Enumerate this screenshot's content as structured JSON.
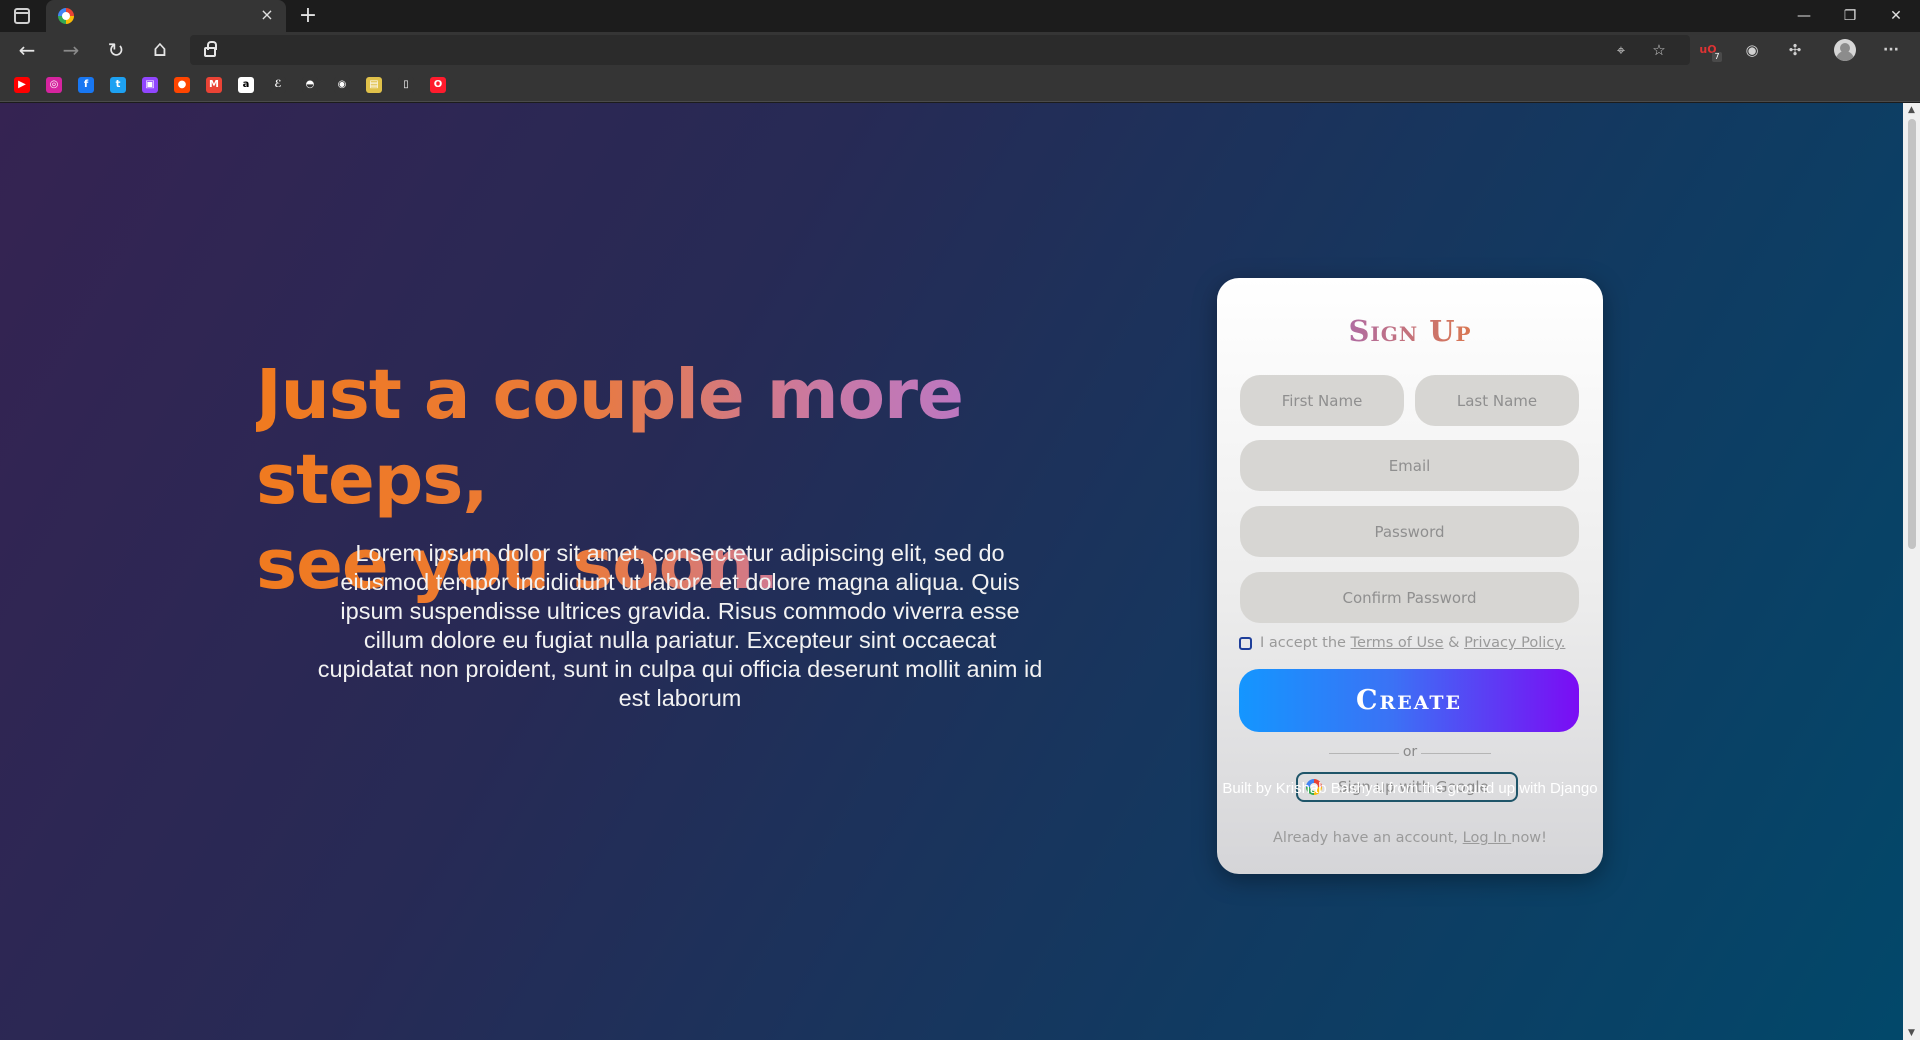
{
  "browser": {
    "tab_close": "×",
    "new_tab": "+",
    "window_controls": {
      "minimize": "—",
      "restore": "❐",
      "close": "✕"
    },
    "nav": {
      "back": "←",
      "forward": "→",
      "reload": "↻",
      "home": "⌂"
    },
    "toolbar_icons": [
      "location-icon",
      "favorites-icon",
      "ublock-extension-icon",
      "extension-icon",
      "extensions-puzzle-icon",
      "profile-avatar",
      "more-menu-icon"
    ],
    "more_menu": "···",
    "ublock_badge": "7"
  },
  "bookmarks": [
    {
      "name": "youtube",
      "glyph": "▶",
      "color": "#ff0000"
    },
    {
      "name": "instagram",
      "glyph": "◎",
      "color": "#d6249f"
    },
    {
      "name": "facebook",
      "glyph": "f",
      "color": "#1877f2"
    },
    {
      "name": "twitter",
      "glyph": "t",
      "color": "#1da1f2"
    },
    {
      "name": "twitch",
      "glyph": "▣",
      "color": "#9146ff"
    },
    {
      "name": "reddit",
      "glyph": "●",
      "color": "#ff4500"
    },
    {
      "name": "gmail",
      "glyph": "M",
      "color": "#ea4335"
    },
    {
      "name": "amazon",
      "glyph": "a",
      "color": "#ffffff"
    },
    {
      "name": "etsy",
      "glyph": "ℰ",
      "color": "#353535"
    },
    {
      "name": "bookmark-10",
      "glyph": "◓",
      "color": "#353535"
    },
    {
      "name": "github",
      "glyph": "◉",
      "color": "#353535"
    },
    {
      "name": "bookmark-12",
      "glyph": "▤",
      "color": "#e0c14a"
    },
    {
      "name": "document",
      "glyph": "▯",
      "color": "#353535"
    },
    {
      "name": "opera",
      "glyph": "O",
      "color": "#ff1b2d"
    }
  ],
  "hero": {
    "headline_line1": "Just a couple more steps,",
    "headline_line2": "see you soon.",
    "body": "Lorem ipsum dolor sit amet, consectetur adipiscing elit, sed do eiusmod tempor incididunt ut labore et dolore magna aliqua. Quis ipsum suspendisse ultrices gravida. Risus commodo viverra esse cillum dolore eu fugiat nulla pariatur. Excepteur sint occaecat cupidatat non proident, sunt in culpa qui officia deserunt mollit anim id est laborum"
  },
  "signup": {
    "title": "Sign Up",
    "first_name_placeholder": "First Name",
    "last_name_placeholder": "Last Name",
    "email_placeholder": "Email",
    "password_placeholder": "Password",
    "confirm_password_placeholder": "Confirm Password",
    "terms_prefix": "I accept the ",
    "terms_link": "Terms of Use",
    "terms_and": " & ",
    "privacy_link": "Privacy Policy.",
    "create_button": "Create",
    "or_text": "or",
    "google_button": "Sign up with Google",
    "login_prefix": "Already have an account, ",
    "login_link": "Log In ",
    "login_suffix": "now!"
  },
  "footer": "Built by Krishab Bashyal from the ground up with Django",
  "colors": {
    "headline_gradient": [
      "#f07a1f",
      "#c979a6",
      "#a774ea"
    ],
    "create_gradient": [
      "#1496ff",
      "#7b0cf4"
    ],
    "page_gradient": [
      "#352352",
      "#02486a"
    ]
  }
}
